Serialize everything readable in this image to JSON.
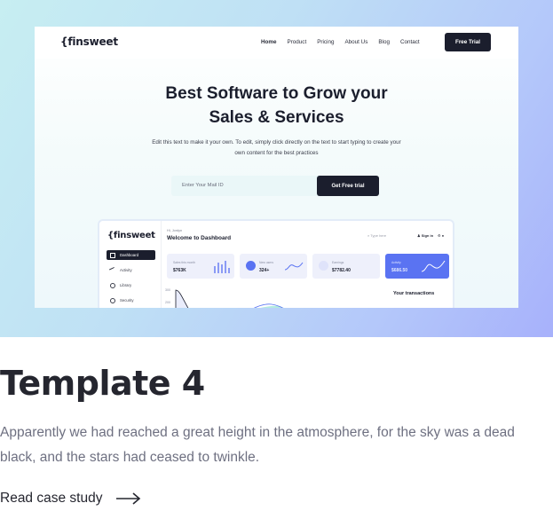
{
  "preview": {
    "site": {
      "logo": "{finsweet",
      "nav": [
        "Home",
        "Product",
        "Pricing",
        "About Us",
        "Blog",
        "Contact"
      ],
      "nav_button": "Free Trial",
      "headline": "Best Software to Grow your Sales & Services",
      "subtext": "Edit this text to make it your own. To edit, simply click directly on the text to start typing to create your own content for the best practices",
      "email_placeholder": "Enter Your Mail ID",
      "cta": "Get Free trial"
    },
    "dashboard": {
      "logo": "{finsweet",
      "greeting": "Hi, Jordyn",
      "title": "Welcome to Dashboard",
      "search_placeholder": "Type here",
      "sign_in": "Sign in",
      "sidebar": [
        "Dashboard",
        "Activity",
        "Library",
        "Security"
      ],
      "cards": [
        {
          "label": "Sales this month",
          "value": "$763K"
        },
        {
          "label": "New users",
          "value": "324+"
        },
        {
          "label": "Earnings",
          "value": "$7782.40"
        },
        {
          "label": "Activity",
          "value": "$686.50"
        }
      ],
      "axis": [
        "300",
        "200"
      ],
      "transactions_title": "Your transactions"
    }
  },
  "content": {
    "title": "Template 4",
    "description": "Apparently we had reached a great height in the atmosphere, for the sky was a dead black, and the stars had ceased to twinkle.",
    "link_label": "Read case study"
  },
  "colors": {
    "dark": "#1b1e2d",
    "accent": "#5a73f2",
    "text": "#25262f",
    "muted": "#6e7081"
  }
}
